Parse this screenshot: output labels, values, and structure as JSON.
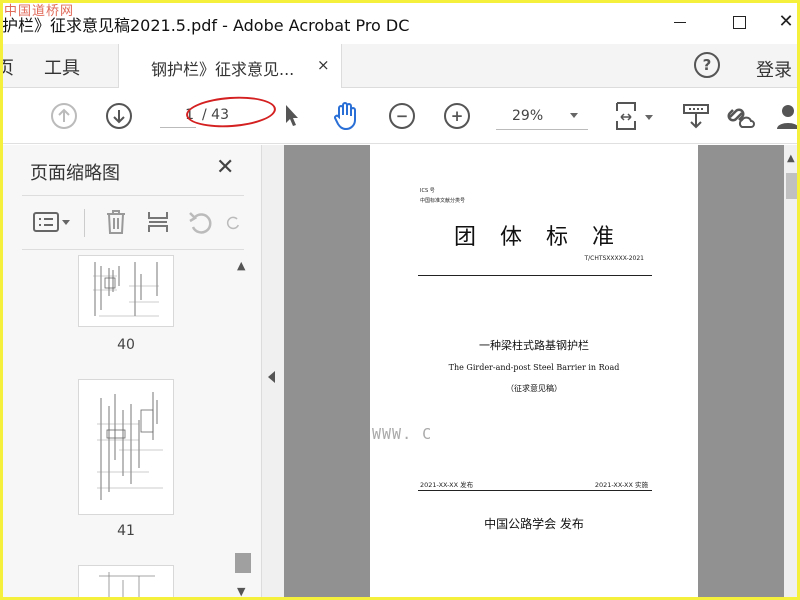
{
  "window": {
    "title": "护栏》征求意见稿2021.5.pdf - Adobe Acrobat Pro DC",
    "watermark_top": "中国道桥网",
    "close_glyph": "✕"
  },
  "tabbar": {
    "menu_home": "页",
    "menu_tools": "工具",
    "doc_tab_label": "钢护栏》征求意见...",
    "doc_tab_close": "×",
    "help": "?",
    "login": "登录"
  },
  "toolbar": {
    "current_page": "1",
    "total_pages": "/ 43",
    "zoom": "29%"
  },
  "left_panel": {
    "title": "页面缩略图",
    "close": "✕",
    "thumbnails": [
      {
        "label": "40"
      },
      {
        "label": "41"
      }
    ]
  },
  "document": {
    "ics": "ICS 号",
    "ccs": "中国标准文献分类号",
    "heading": "团体标准",
    "code": "T/CHTSXXXXX-2021",
    "main_title": "一种梁柱式路基钢护栏",
    "english_title": "The Girder-and-post Steel Barrier in Road",
    "note": "（征求意见稿）",
    "publish_date": "2021-XX-XX 发布",
    "implement_date": "2021-XX-XX 实施",
    "publisher": "中国公路学会  发布"
  },
  "bottom_watermark": "WWW. C",
  "colors": {
    "frame": "#f5f03c",
    "annotation": "#d42020",
    "doc_background": "#919191",
    "active_icon": "#2a6fd6"
  },
  "icons": [
    "arrow-up-icon",
    "arrow-down-icon",
    "select-cursor-icon",
    "hand-tool-icon",
    "zoom-out-icon",
    "zoom-in-icon",
    "fit-page-icon",
    "export-icon",
    "share-link-icon",
    "user-icon",
    "options-icon",
    "trash-icon",
    "insert-icon",
    "undo-icon",
    "redo-icon"
  ]
}
